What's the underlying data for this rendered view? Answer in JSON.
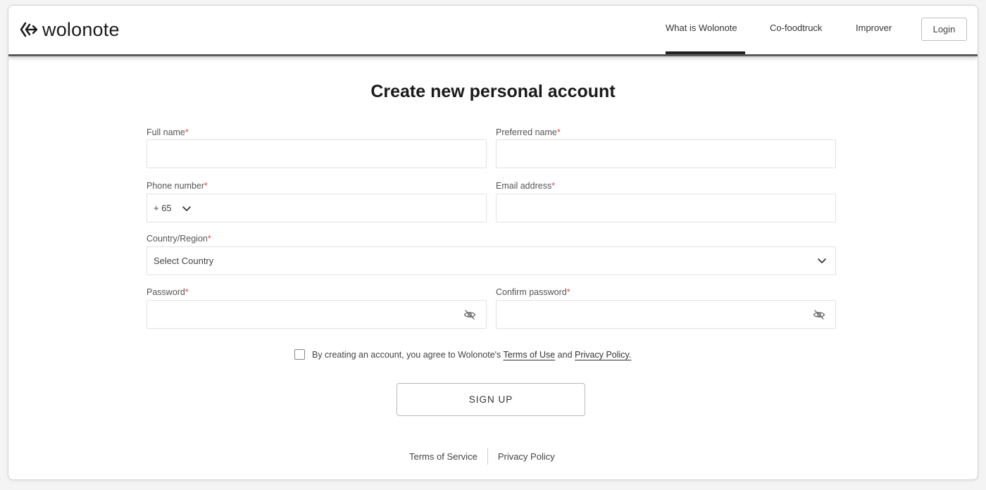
{
  "brand": {
    "name": "wolonote",
    "logo_icon": "wolonote-logo-icon"
  },
  "nav": {
    "items": [
      {
        "label": "What is Wolonote",
        "active": true
      },
      {
        "label": "Co-foodtruck",
        "active": false
      },
      {
        "label": "Improver",
        "active": false
      }
    ],
    "login_label": "Login"
  },
  "form": {
    "title": "Create new personal account",
    "required_mark": "*",
    "full_name": {
      "label": "Full name",
      "value": ""
    },
    "preferred_name": {
      "label": "Preferred name",
      "value": ""
    },
    "phone": {
      "label": "Phone number",
      "country_code": "+ 65",
      "value": ""
    },
    "email": {
      "label": "Email address",
      "value": ""
    },
    "country": {
      "label": "Country/Region",
      "selected": "Select Country"
    },
    "password": {
      "label": "Password",
      "value": ""
    },
    "confirm_password": {
      "label": "Confirm password",
      "value": ""
    },
    "consent": {
      "text_before": "By creating an account, you agree to Wolonote's",
      "terms_link": "Terms of Use",
      "text_middle": "and",
      "privacy_link": "Privacy Policy.",
      "checked": false
    },
    "submit_label": "SIGN UP"
  },
  "footer": {
    "terms": "Terms of Service",
    "privacy": "Privacy Policy"
  },
  "colors": {
    "accent_dark": "#222222",
    "required": "#e0474c"
  }
}
